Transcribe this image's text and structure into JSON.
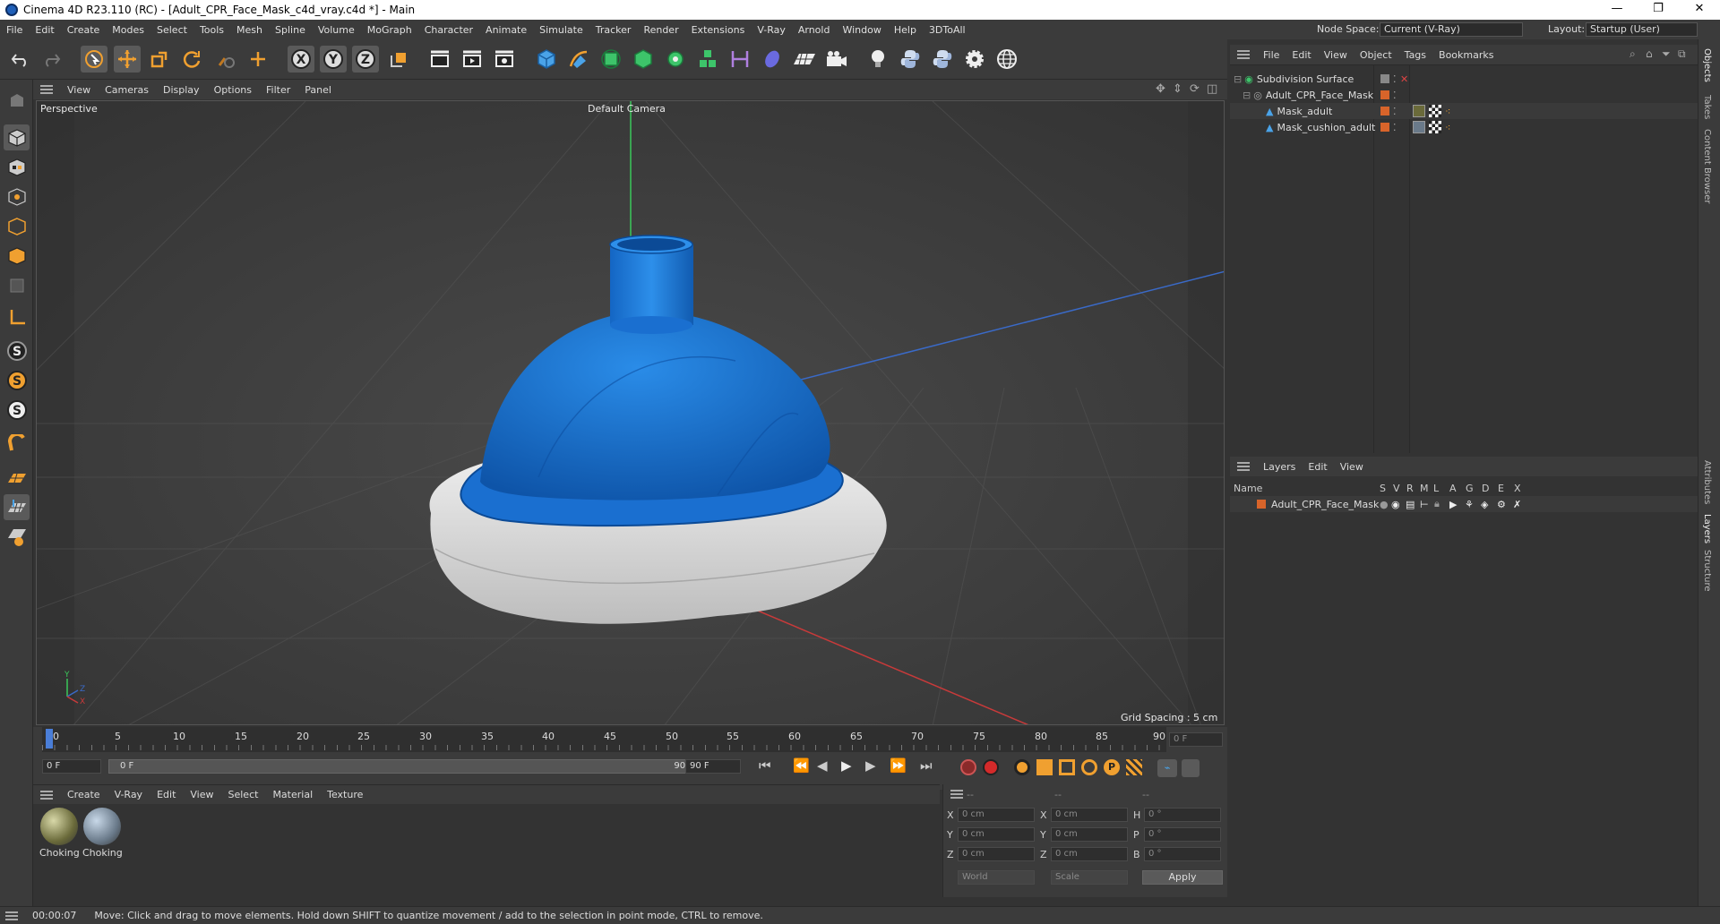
{
  "window": {
    "title": "Cinema 4D R23.110 (RC) - [Adult_CPR_Face_Mask_c4d_vray.c4d *] - Main",
    "minimize": "—",
    "maximize": "❐",
    "close": "✕"
  },
  "menubar": {
    "items": [
      "File",
      "Edit",
      "Create",
      "Modes",
      "Select",
      "Tools",
      "Mesh",
      "Spline",
      "Volume",
      "MoGraph",
      "Character",
      "Animate",
      "Simulate",
      "Tracker",
      "Render",
      "Extensions",
      "V-Ray",
      "Arnold",
      "Window",
      "Help",
      "3DToAll"
    ],
    "node_space_label": "Node Space:",
    "node_space_value": "Current (V-Ray)",
    "layout_label": "Layout:",
    "layout_value": "Startup (User)"
  },
  "viewport": {
    "menu": [
      "View",
      "Cameras",
      "Display",
      "Options",
      "Filter",
      "Panel"
    ],
    "label": "Perspective",
    "camera": "Default Camera",
    "grid_spacing": "Grid Spacing : 5 cm",
    "axis_y": "Y",
    "axis_z": "Z",
    "axis_x": "X"
  },
  "timeline": {
    "ticks": [
      "0",
      "5",
      "10",
      "15",
      "20",
      "25",
      "30",
      "35",
      "40",
      "45",
      "50",
      "55",
      "60",
      "65",
      "70",
      "75",
      "80",
      "85",
      "90"
    ],
    "current_frame": "0 F",
    "start_field": "0 F",
    "range_start": "0 F",
    "range_end": "90 F",
    "end_field": "90 F",
    "preview_end": "90 F"
  },
  "materials": {
    "menu": [
      "Create",
      "V-Ray",
      "Edit",
      "View",
      "Select",
      "Material",
      "Texture"
    ],
    "items": [
      {
        "name": "Choking"
      },
      {
        "name": "Choking"
      }
    ]
  },
  "coords": {
    "header": [
      "--",
      "--",
      "--"
    ],
    "rows": [
      {
        "a": "X",
        "av": "0 cm",
        "b": "X",
        "bv": "0 cm",
        "c": "H",
        "cv": "0 °"
      },
      {
        "a": "Y",
        "av": "0 cm",
        "b": "Y",
        "bv": "0 cm",
        "c": "P",
        "cv": "0 °"
      },
      {
        "a": "Z",
        "av": "0 cm",
        "b": "Z",
        "bv": "0 cm",
        "c": "B",
        "cv": "0 °"
      }
    ],
    "space": "World",
    "mode": "Scale",
    "apply": "Apply"
  },
  "objects": {
    "menu": [
      "File",
      "Edit",
      "View",
      "Object",
      "Tags",
      "Bookmarks"
    ],
    "tree": [
      {
        "name": "Subdivision Surface",
        "level": 0
      },
      {
        "name": "Adult_CPR_Face_Mask",
        "level": 1
      },
      {
        "name": "Mask_adult",
        "level": 2
      },
      {
        "name": "Mask_cushion_adult",
        "level": 2
      }
    ]
  },
  "layers": {
    "menu": [
      "Layers",
      "Edit",
      "View"
    ],
    "columns": [
      "Name",
      "S",
      "V",
      "R",
      "M",
      "L",
      "A",
      "G",
      "D",
      "E",
      "X"
    ],
    "rows": [
      {
        "name": "Adult_CPR_Face_Mask"
      }
    ]
  },
  "side_tabs": [
    "Objects",
    "Takes",
    "Content Browser",
    "Attributes",
    "Layers",
    "Structure"
  ],
  "status": {
    "time": "00:00:07",
    "message": "Move: Click and drag to move elements. Hold down SHIFT to quantize movement / add to the selection in point mode, CTRL to remove."
  },
  "colors": {
    "mask_blue": "#1a73d2",
    "cushion_white": "#e8e8e8",
    "accent_orange": "#d8642a",
    "x_axis": "#c83a3a",
    "y_axis": "#3ac85a",
    "z_axis": "#3a6ac8"
  }
}
